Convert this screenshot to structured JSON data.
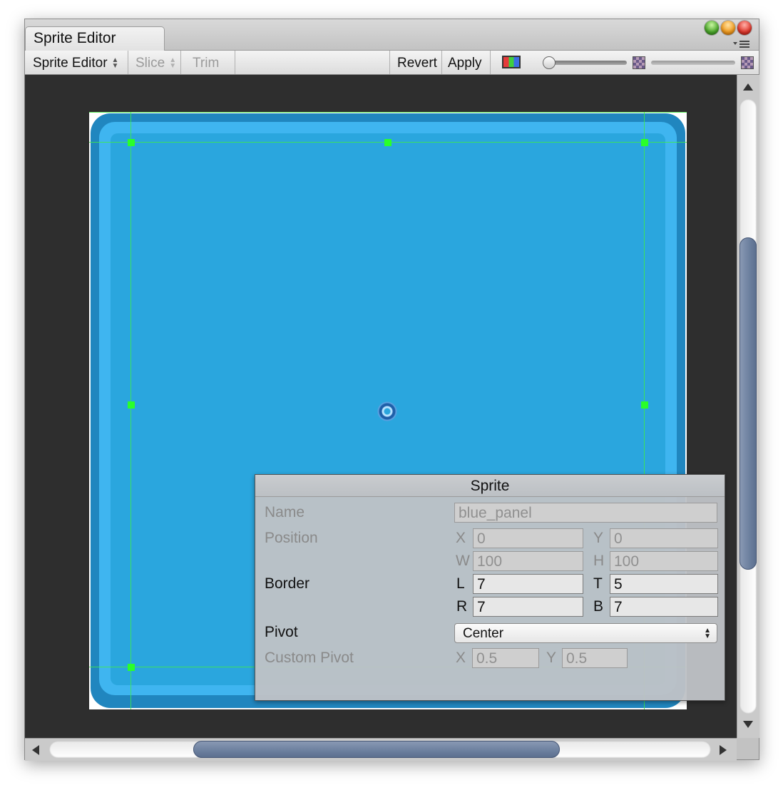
{
  "window": {
    "tab_title": "Sprite Editor"
  },
  "toolbar": {
    "mode_label": "Sprite Editor",
    "slice_label": "Slice",
    "trim_label": "Trim",
    "revert_label": "Revert",
    "apply_label": "Apply"
  },
  "icons": {
    "updown": "↕",
    "menu": "▾☰"
  },
  "sprite_panel": {
    "title": "Sprite",
    "name_label": "Name",
    "name_value": "blue_panel",
    "position_label": "Position",
    "x_label": "X",
    "x_value": "0",
    "y_label": "Y",
    "y_value": "0",
    "w_label": "W",
    "w_value": "100",
    "h_label": "H",
    "h_value": "100",
    "border_label": "Border",
    "l_label": "L",
    "l_value": "7",
    "t_label": "T",
    "t_value": "5",
    "r_label": "R",
    "r_value": "7",
    "b_label": "B",
    "b_value": "7",
    "pivot_label": "Pivot",
    "pivot_value": "Center",
    "custom_pivot_label": "Custom Pivot",
    "cx_label": "X",
    "cx_value": "0.5",
    "cy_label": "Y",
    "cy_value": "0.5"
  },
  "colors": {
    "sprite_blue": "#2aa6de",
    "guide_green": "#2aff2a",
    "canvas_bg": "#2e2e2e"
  }
}
